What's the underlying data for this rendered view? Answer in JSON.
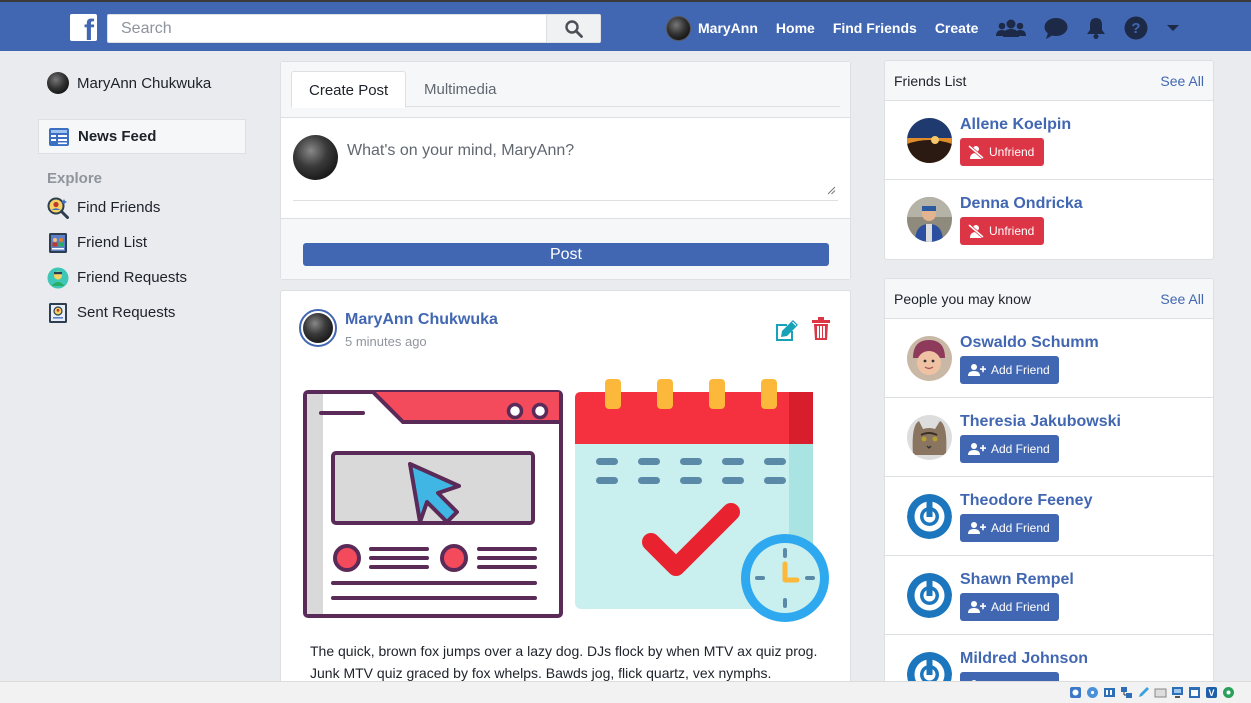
{
  "header": {
    "logo_letter": "f",
    "search_placeholder": "Search",
    "user_name": "MaryAnn",
    "nav": [
      "Home",
      "Find Friends",
      "Create"
    ]
  },
  "sidebar": {
    "user_name": "MaryAnn Chukwuka",
    "news_feed": "News Feed",
    "explore_label": "Explore",
    "items": [
      {
        "label": "Find Friends"
      },
      {
        "label": "Friend List"
      },
      {
        "label": "Friend Requests"
      },
      {
        "label": "Sent Requests"
      }
    ]
  },
  "composer": {
    "tabs": [
      "Create Post",
      "Multimedia"
    ],
    "placeholder": "What's on your mind, MaryAnn?",
    "post_button": "Post"
  },
  "post": {
    "author": "MaryAnn Chukwuka",
    "time": "5 minutes ago",
    "text": "The quick, brown fox jumps over a lazy dog. DJs flock by when MTV ax quiz prog. Junk MTV quiz graced by fox whelps. Bawds jog, flick quartz, vex nymphs."
  },
  "friends_panel": {
    "title": "Friends List",
    "see_all": "See All",
    "button_label": "Unfriend",
    "people": [
      {
        "name": "Allene Koelpin"
      },
      {
        "name": "Denna Ondricka"
      }
    ]
  },
  "suggest_panel": {
    "title": "People you may know",
    "see_all": "See All",
    "button_label": "Add Friend",
    "people": [
      {
        "name": "Oswaldo Schumm"
      },
      {
        "name": "Theresia Jakubowski"
      },
      {
        "name": "Theodore Feeney"
      },
      {
        "name": "Shawn Rempel"
      },
      {
        "name": "Mildred Johnson"
      }
    ]
  },
  "colors": {
    "brand": "#4267b2",
    "danger": "#dc3545",
    "background": "#e9ebee"
  }
}
